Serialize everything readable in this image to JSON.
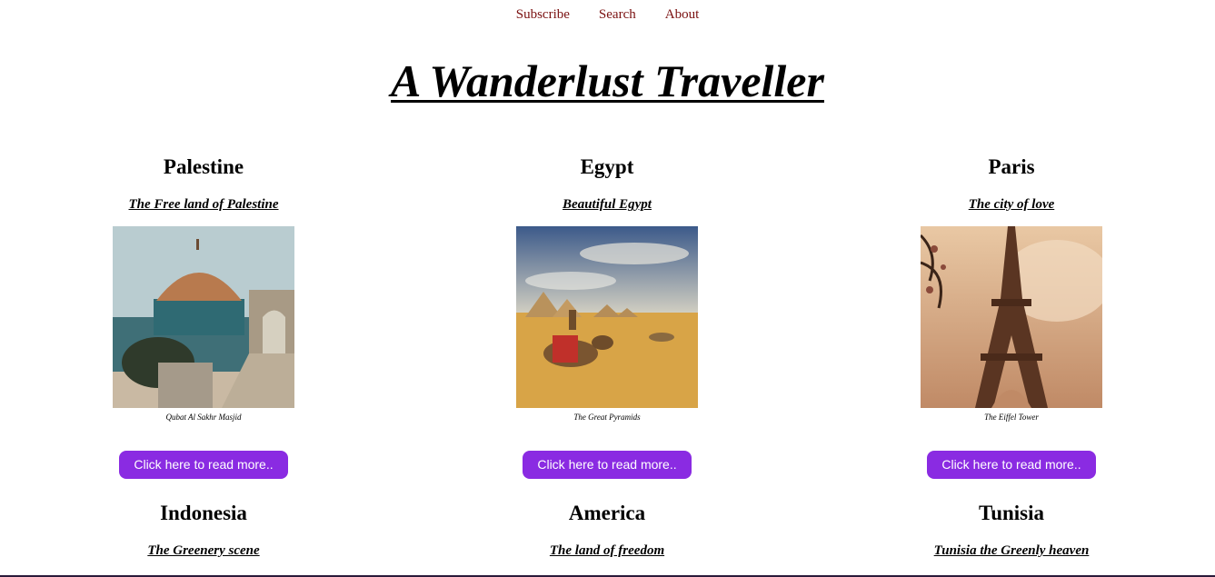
{
  "nav": {
    "subscribe": "Subscribe",
    "search": "Search",
    "about": "About"
  },
  "site_title": "A Wanderlust Traveller",
  "destinations": [
    {
      "name": "Palestine",
      "tagline": "The Free land of Palestine",
      "caption": "Qubat Al Sakhr Masjid",
      "button": "Click here to read more.."
    },
    {
      "name": "Egypt",
      "tagline": "Beautiful Egypt",
      "caption": "The Great Pyramids",
      "button": "Click here to read more.."
    },
    {
      "name": "Paris",
      "tagline": "The city of love",
      "caption": "The Eiffel Tower",
      "button": "Click here to read more.."
    },
    {
      "name": "Indonesia",
      "tagline": "The Greenery scene"
    },
    {
      "name": "America",
      "tagline": "The land of freedom"
    },
    {
      "name": "Tunisia",
      "tagline": "Tunisia the Greenly heaven"
    }
  ],
  "colors": {
    "nav_link": "#7a1010",
    "button_bg": "#8a2be2",
    "button_text": "#ffffff"
  }
}
